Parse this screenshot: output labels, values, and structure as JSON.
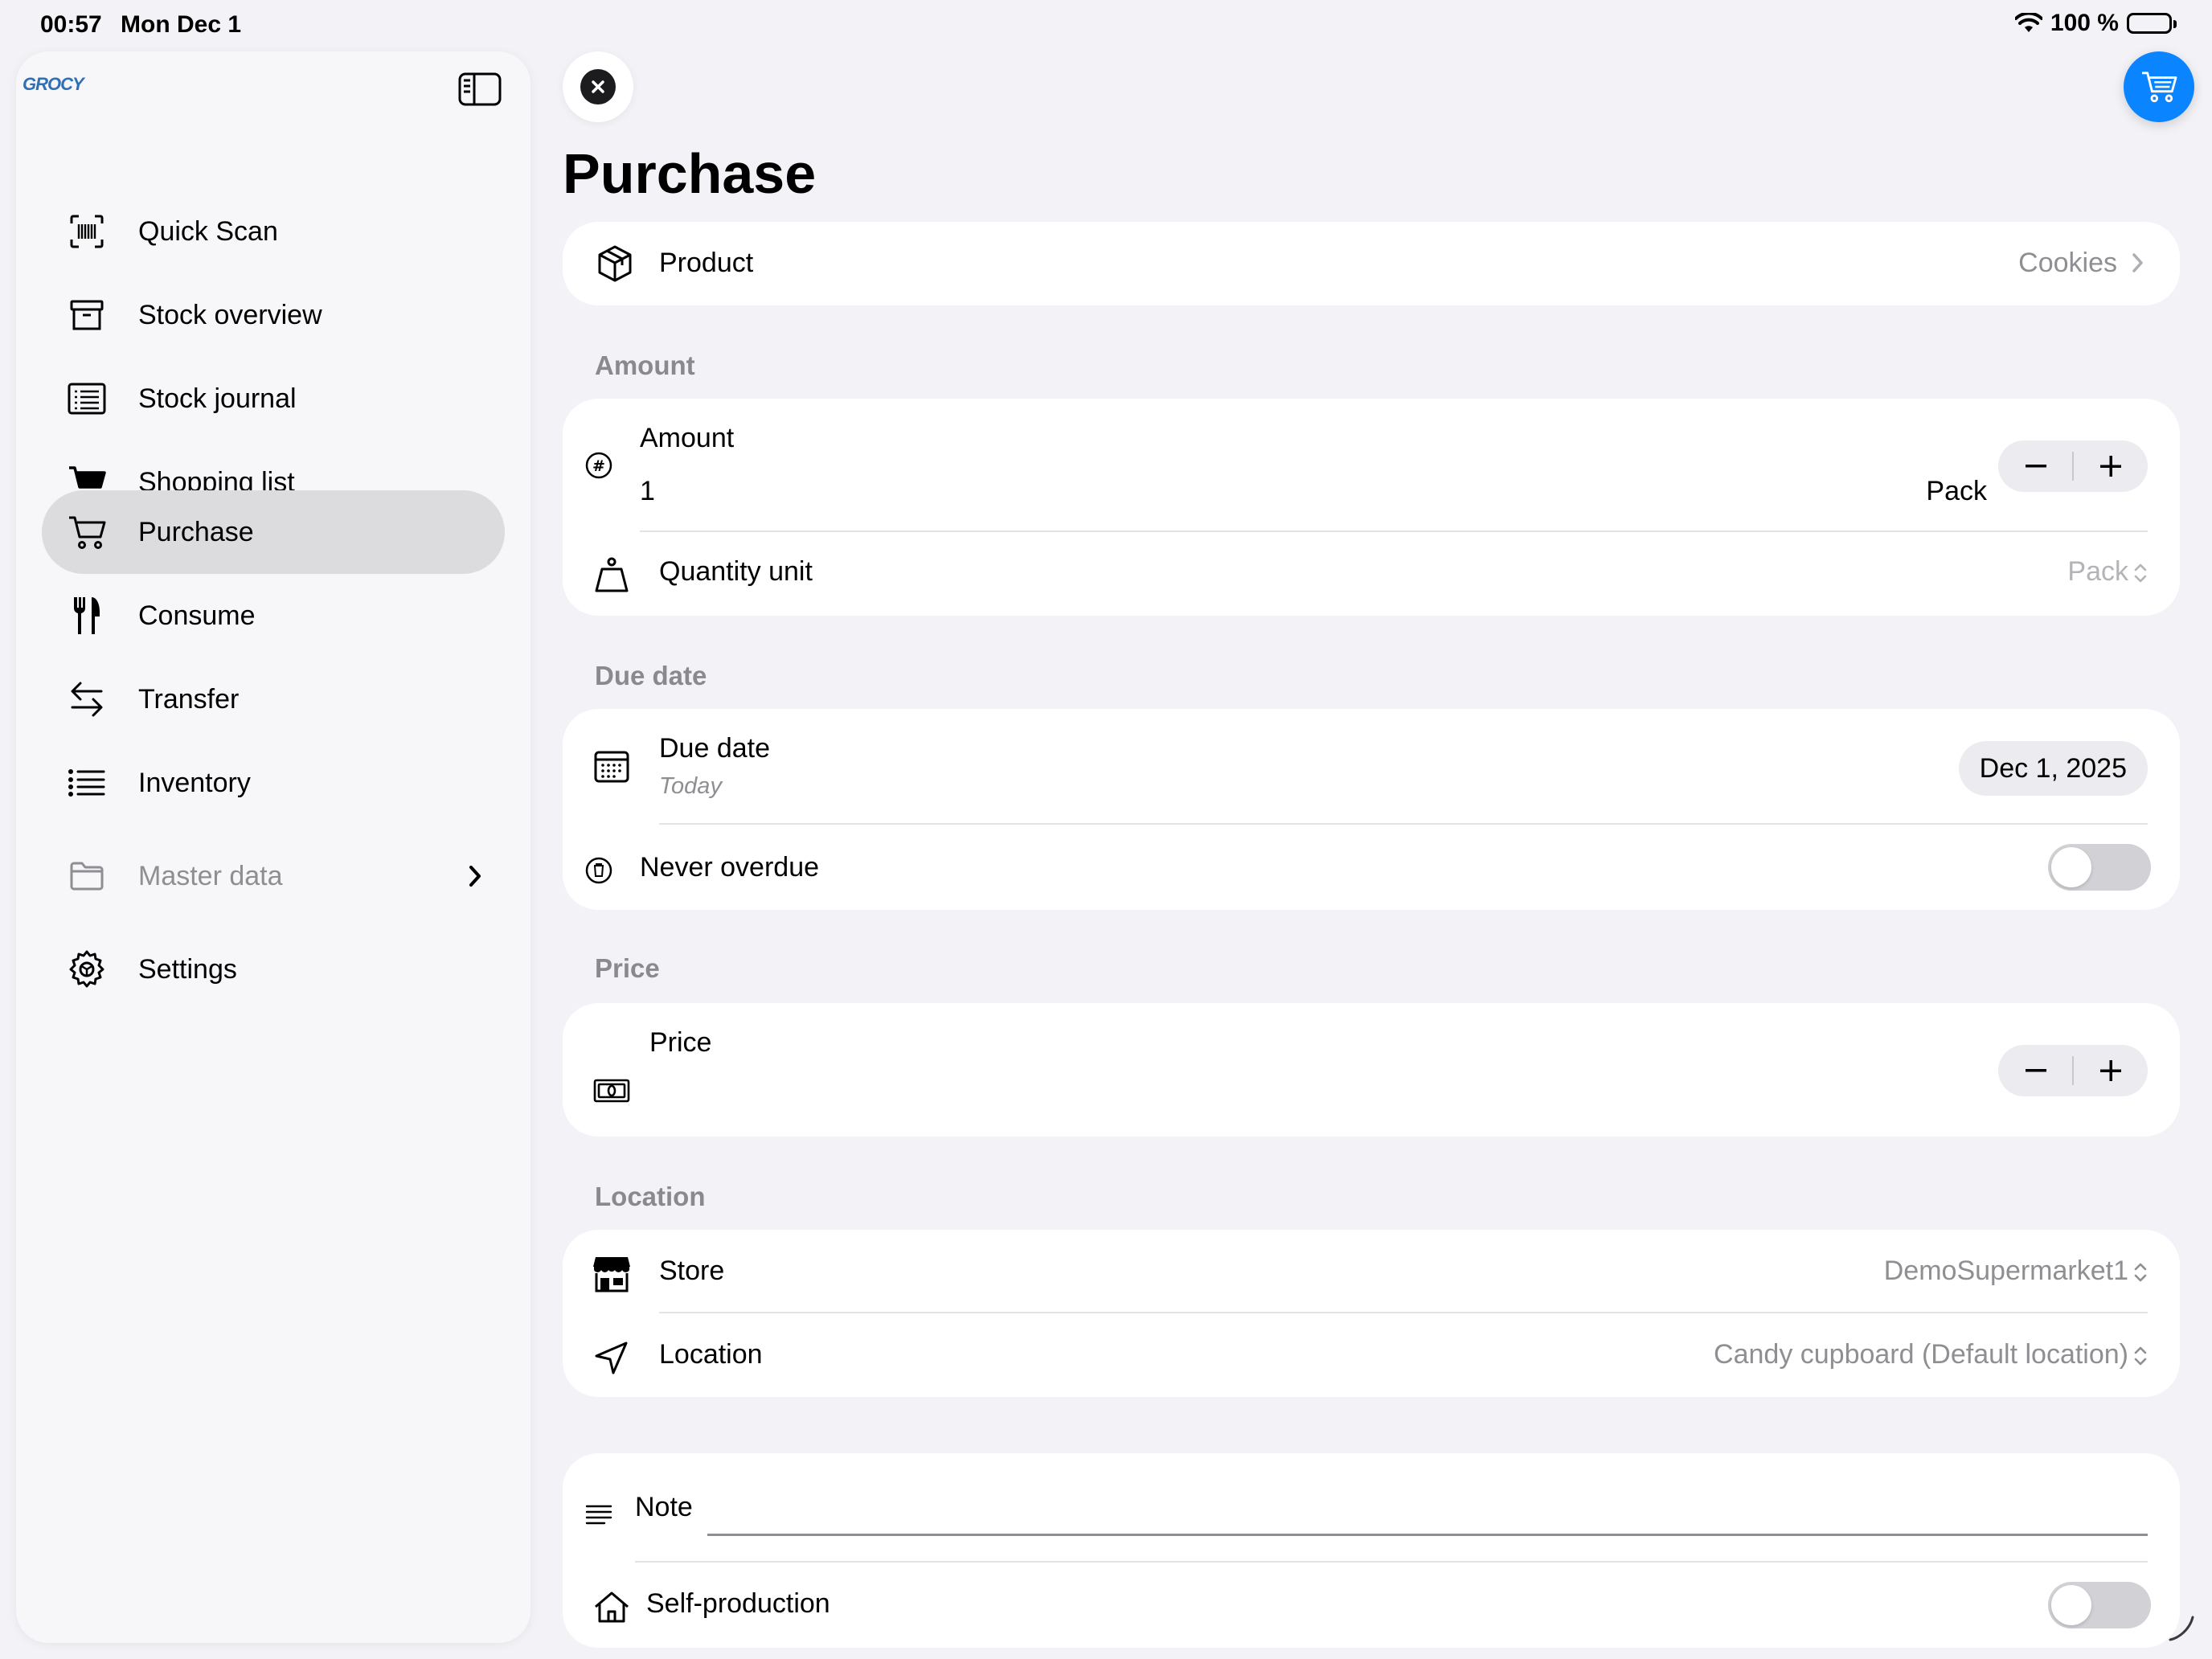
{
  "status_bar": {
    "time": "00:57",
    "date": "Mon Dec 1",
    "battery": "100 %"
  },
  "sidebar": {
    "logo": "GROCY",
    "items": [
      {
        "label": "Quick Scan",
        "icon": "barcode-scan-icon"
      },
      {
        "label": "Stock overview",
        "icon": "archive-box-icon"
      },
      {
        "label": "Stock journal",
        "icon": "list-document-icon"
      },
      {
        "label": "Shopping list",
        "icon": "cart-filled-icon"
      },
      {
        "label": "Purchase",
        "icon": "cart-icon",
        "active": true
      },
      {
        "label": "Consume",
        "icon": "fork-knife-icon"
      },
      {
        "label": "Transfer",
        "icon": "arrows-left-right-icon"
      },
      {
        "label": "Inventory",
        "icon": "list-bullet-icon"
      },
      {
        "label": "Master data",
        "icon": "folder-icon",
        "disabled": true
      },
      {
        "label": "Settings",
        "icon": "gear-icon"
      }
    ]
  },
  "page": {
    "title": "Purchase"
  },
  "product": {
    "label": "Product",
    "value": "Cookies"
  },
  "amount_section": {
    "header": "Amount",
    "amount_label": "Amount",
    "amount_value": "1",
    "amount_unit": "Pack",
    "quantity_unit_label": "Quantity unit",
    "quantity_unit_value": "Pack"
  },
  "due_date_section": {
    "header": "Due date",
    "due_date_label": "Due date",
    "due_date_sub": "Today",
    "due_date_value": "Dec 1, 2025",
    "never_overdue_label": "Never overdue",
    "never_overdue_on": false
  },
  "price_section": {
    "header": "Price",
    "price_label": "Price"
  },
  "location_section": {
    "header": "Location",
    "store_label": "Store",
    "store_value": "DemoSupermarket1",
    "location_label": "Location",
    "location_value": "Candy cupboard (Default location)"
  },
  "extra_section": {
    "note_label": "Note",
    "note_value": "",
    "self_production_label": "Self-production",
    "self_production_on": false
  },
  "colors": {
    "accent": "#0a84ff",
    "background": "#f2f2f7",
    "sidebar_active": "#dcdcdf"
  }
}
